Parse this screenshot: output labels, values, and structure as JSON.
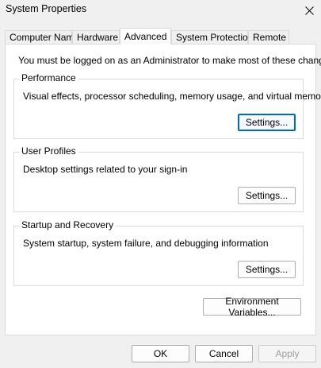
{
  "window": {
    "title": "System Properties"
  },
  "tabs": [
    {
      "label": "Computer Name",
      "active": false
    },
    {
      "label": "Hardware",
      "active": false
    },
    {
      "label": "Advanced",
      "active": true
    },
    {
      "label": "System Protection",
      "active": false
    },
    {
      "label": "Remote",
      "active": false
    }
  ],
  "advanced": {
    "admin_note": "You must be logged on as an Administrator to make most of these changes.",
    "performance": {
      "title": "Performance",
      "description": "Visual effects, processor scheduling, memory usage, and virtual memory",
      "button": "Settings..."
    },
    "user_profiles": {
      "title": "User Profiles",
      "description": "Desktop settings related to your sign-in",
      "button": "Settings..."
    },
    "startup_recovery": {
      "title": "Startup and Recovery",
      "description": "System startup, system failure, and debugging information",
      "button": "Settings..."
    },
    "env_button": "Environment Variables..."
  },
  "footer": {
    "ok": "OK",
    "cancel": "Cancel",
    "apply": "Apply"
  },
  "icons": {
    "close": "close-icon"
  },
  "colors": {
    "focus_border": "#0067c0",
    "window_bg": "#f0f0f0",
    "panel_bg": "#ffffff",
    "disabled_text": "#a0a0a0"
  }
}
